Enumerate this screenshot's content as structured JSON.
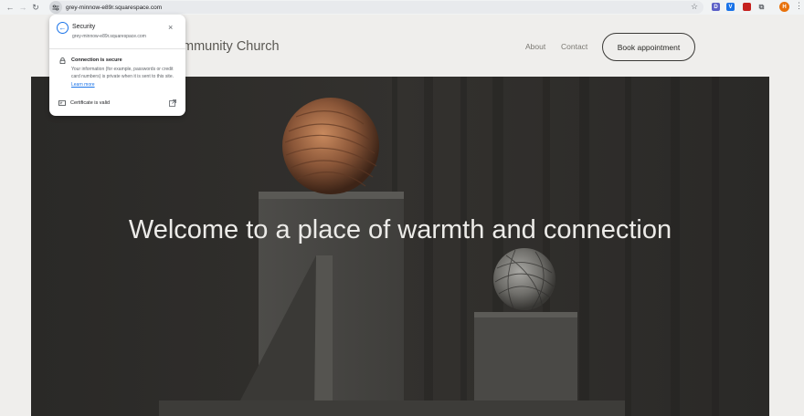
{
  "browser": {
    "url": "grey-minnow-e89r.squarespace.com",
    "extensions": [
      "D",
      "V",
      "",
      ""
    ],
    "profile_initial": "H",
    "icons": [
      "back-arrow-icon",
      "forward-arrow-icon",
      "reload-icon",
      "site-settings-icon",
      "bookmark-star-icon",
      "extensions-puzzle-icon",
      "menu-dots-icon"
    ]
  },
  "site": {
    "title": "mmunity Church",
    "nav": [
      "About",
      "Contact"
    ],
    "book_label": "Book appointment",
    "hero_heading": "Welcome to a place of warmth and connection"
  },
  "security_popup": {
    "title": "Security",
    "subtitle": "grey-minnow-e89r.squarespace.com",
    "connection_title": "Connection is secure",
    "connection_desc": "Your information (for example, passwords or credit card numbers) is private when it is sent to this site.",
    "learn_more": "Learn more",
    "certificate": "Certificate is valid"
  },
  "colors": {
    "accent": "#1a73e8",
    "hero_bg": "#2b2a28",
    "page_bg": "#efeeec"
  }
}
